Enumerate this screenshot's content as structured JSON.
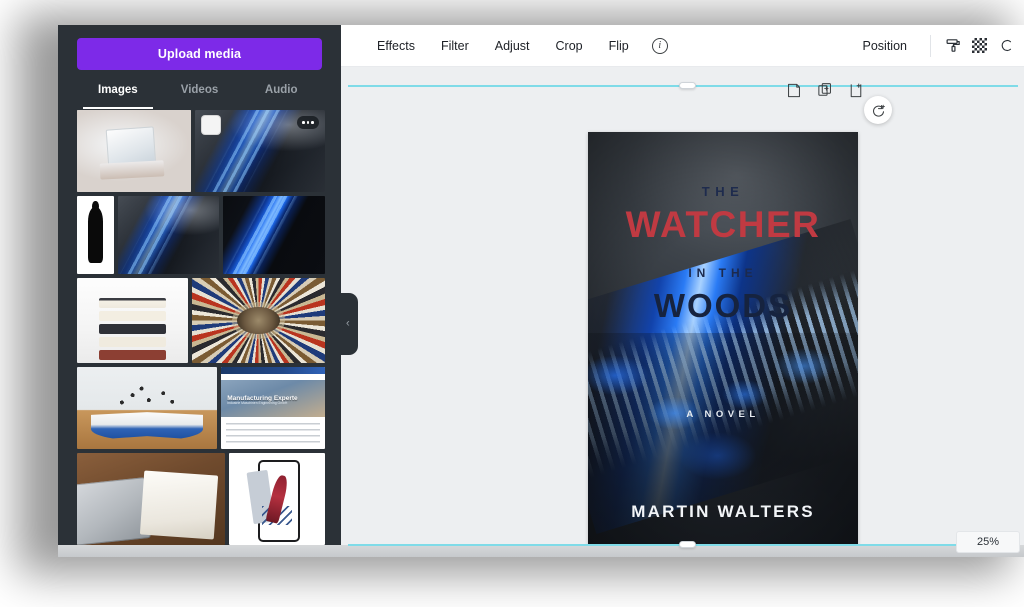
{
  "app": {
    "zoom_level": "25%"
  },
  "sidebar": {
    "upload_button": "Upload media",
    "tabs": [
      {
        "label": "Images",
        "active": true
      },
      {
        "label": "Videos",
        "active": false
      },
      {
        "label": "Audio",
        "active": false
      }
    ],
    "thumbnails": [
      {
        "name": "laptop-on-desk",
        "art": "art-laptop",
        "selected": false,
        "has_more": false
      },
      {
        "name": "blue-lit-bridge",
        "art": "art-bridge",
        "selected": true,
        "has_more": true
      },
      {
        "name": "person-silhouette",
        "art": "art-silhouette",
        "selected": false,
        "has_more": false
      },
      {
        "name": "blue-lit-bridge-2",
        "art": "art-bridge",
        "selected": false,
        "has_more": false
      },
      {
        "name": "blue-lit-bridge-dark",
        "art": "art-bridge-dark",
        "selected": false,
        "has_more": false
      },
      {
        "name": "stack-of-books",
        "art": "art-books-stack",
        "selected": false,
        "has_more": false
      },
      {
        "name": "circular-bookshelf",
        "art": "art-book-circle",
        "selected": false,
        "has_more": false
      },
      {
        "name": "open-book-popup",
        "art": "art-open-book",
        "selected": false,
        "has_more": false
      },
      {
        "name": "manufacturing-website",
        "art": "art-webpage",
        "selected": false,
        "has_more": false
      },
      {
        "name": "desk-workspace",
        "art": "art-desk",
        "selected": false,
        "has_more": false
      },
      {
        "name": "phone-with-pen",
        "art": "art-phone-pen",
        "selected": false,
        "has_more": false
      }
    ],
    "webpage_thumb": {
      "title": "Manufacturing Experte",
      "subtitle": "Industrie Maschinen Engineering GmbH"
    },
    "collapse_chevron": "‹"
  },
  "toolbar": {
    "items": [
      {
        "label": "Effects"
      },
      {
        "label": "Filter"
      },
      {
        "label": "Adjust"
      },
      {
        "label": "Crop"
      },
      {
        "label": "Flip"
      }
    ],
    "info_glyph": "i",
    "position_label": "Position"
  },
  "cover": {
    "line_the": "THE",
    "line_title": "WATCHER",
    "line_in_the": "IN THE",
    "line_subtitle": "WOODS",
    "line_novel": "A NOVEL",
    "line_author": "MARTIN WALTERS"
  },
  "colors": {
    "accent_purple": "#7d2ae8",
    "sidebar_bg": "#2b3137",
    "canvas_bg": "#edeff1",
    "guide_cyan": "#7fdbe8",
    "title_red": "#c03a42",
    "title_navy": "#1c2a4d"
  }
}
